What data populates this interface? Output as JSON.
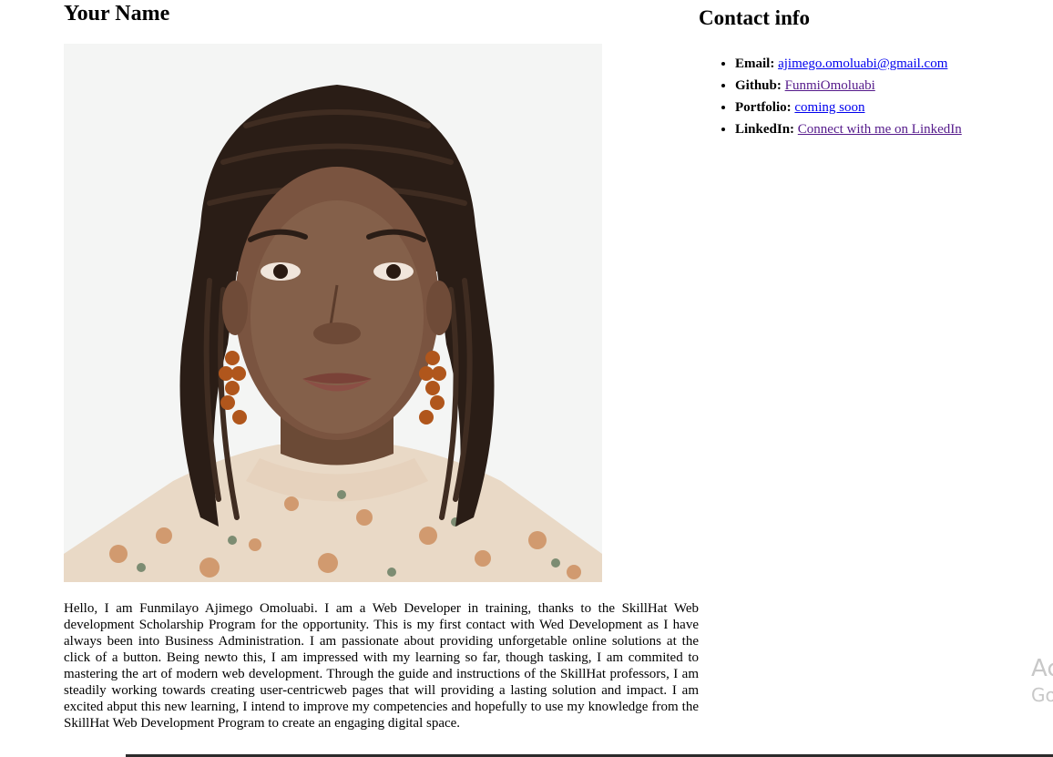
{
  "header": {
    "name": "Your Name"
  },
  "profile_photo": {
    "alt": "Profile photo of Funmilayo Ajimego Omoluabi"
  },
  "bio": {
    "text": "Hello, I am Funmilayo Ajimego Omoluabi. I am a Web Developer in training, thanks to the SkillHat Web development Scholarship Program for the opportunity. This is my first contact with Wed Development as I have always been into Business Administration. I am passionate about providing unforgetable online solutions at the click of a button. Being newto this, I am impressed with my learning so far, though tasking, I am commited to mastering the art of modern web development. Through the guide and instructions of the SkillHat professors, I am steadily working towards creating user-centricweb pages that will providing a lasting solution and impact. I am excited abput this new learning, I intend to improve my competencies and hopefully to use my knowledge from the SkillHat Web Development Program to create an engaging digital space."
  },
  "contact": {
    "heading": "Contact info",
    "items": [
      {
        "label": "Email:",
        "link_text": "ajimego.omoluabi@gmail.com"
      },
      {
        "label": "Github:",
        "link_text": "FunmiOmoluabi"
      },
      {
        "label": "Portfolio:",
        "link_text": "coming soon"
      },
      {
        "label": "LinkedIn:",
        "link_text": "Connect with me on LinkedIn"
      }
    ]
  },
  "watermark": {
    "line1": "Ac",
    "line2": "Go"
  },
  "colors": {
    "link": "#0000ee",
    "visited_link": "#551a8b",
    "photo_background": "#f4f5f4"
  }
}
